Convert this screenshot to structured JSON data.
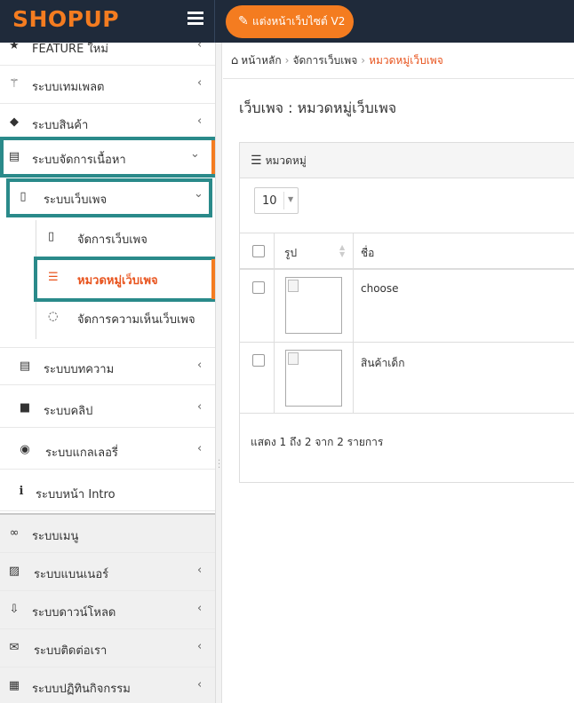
{
  "topbar": {
    "logo_text": "SHOPUP",
    "edit_site_button": "แต่งหน้าเว็บไซต์ V2"
  },
  "sidebar": {
    "partial_item": "FEATURE ใหม่",
    "items": [
      {
        "label": "ระบบเทมเพลต",
        "icon": "magic-wand-icon"
      },
      {
        "label": "ระบบสินค้า",
        "icon": "gift-icon"
      },
      {
        "label": "ระบบจัดการเนื้อหา",
        "icon": "document-icon"
      },
      {
        "label": "ระบบเว็บเพจ",
        "icon": "file-icon"
      },
      {
        "label": "ระบบบทความ",
        "icon": "article-icon"
      },
      {
        "label": "ระบบคลิป",
        "icon": "video-camera-icon"
      },
      {
        "label": "ระบบแกลเลอรี่",
        "icon": "camera-icon"
      },
      {
        "label": "ระบบหน้า Intro",
        "icon": "info-icon"
      },
      {
        "label": "ระบบเมนู",
        "icon": "link-icon"
      },
      {
        "label": "ระบบแบนเนอร์",
        "icon": "image-icon"
      },
      {
        "label": "ระบบดาวน์โหลด",
        "icon": "download-icon"
      },
      {
        "label": "ระบบติดต่อเรา",
        "icon": "envelope-icon"
      },
      {
        "label": "ระบบปฏิทินกิจกรรม",
        "icon": "calendar-icon"
      }
    ],
    "webpage_children": [
      {
        "label": "จัดการเว็บเพจ",
        "icon": "file-icon"
      },
      {
        "label": "หมวดหมู่เว็บเพจ",
        "icon": "list-icon"
      },
      {
        "label": "จัดการความเห็นเว็บเพจ",
        "icon": "comment-icon"
      }
    ]
  },
  "breadcrumb": {
    "home": "หน้าหลัก",
    "middle": "จัดการเว็บเพจ",
    "current": "หมวดหมู่เว็บเพจ"
  },
  "page": {
    "title": "เว็บเพจ : หมวดหมู่เว็บเพจ"
  },
  "panel": {
    "heading": "หมวดหมู่",
    "page_length": "10"
  },
  "table": {
    "columns": [
      "รูป",
      "ชื่อ"
    ],
    "rows": [
      {
        "name": "choose"
      },
      {
        "name": "สินค้าเด็ก"
      }
    ],
    "info": "แสดง 1 ถึง 2 จาก 2 รายการ"
  },
  "colors": {
    "accent": "#f47c20",
    "active_text": "#e8541e",
    "highlight_border": "#2a8a8a",
    "topbar": "#1f2a3a"
  }
}
